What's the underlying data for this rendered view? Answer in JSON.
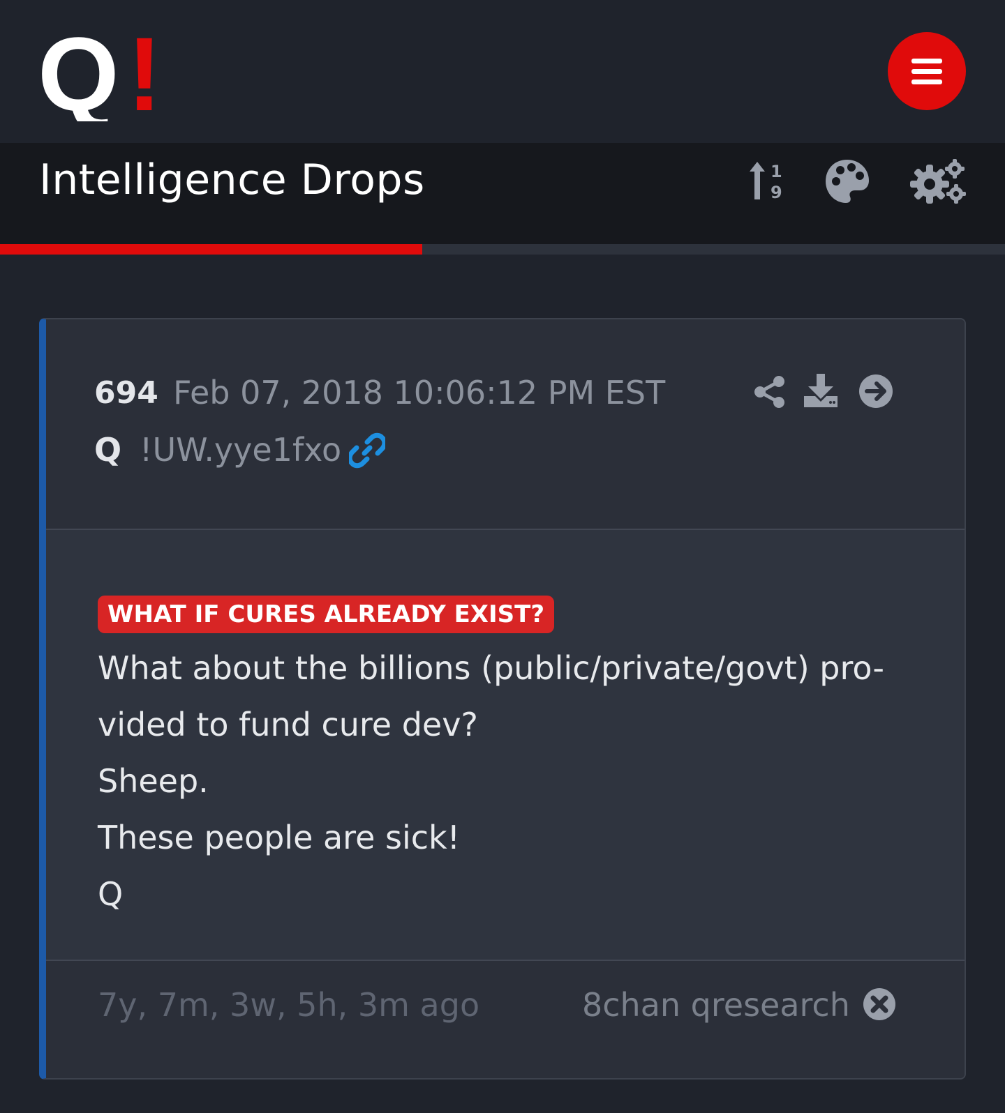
{
  "header": {
    "logo_letter": "Q",
    "logo_mark": "!",
    "menu_icon": "hamburger-icon",
    "accent_color": "#e00b0b"
  },
  "titlebar": {
    "title": "Intelligence Drops",
    "tools": [
      "sort-numeric-icon",
      "palette-icon",
      "gears-icon"
    ]
  },
  "progress": {
    "fraction": 0.42
  },
  "post": {
    "number": "694",
    "date": "Feb 07, 2018 10:06:12 PM EST",
    "author": "Q",
    "tripcode": "!UW.yye1fxo",
    "head_icons": [
      "share-icon",
      "download-icon",
      "arrow-right-circle-icon",
      "link-icon"
    ],
    "tag": "WHAT IF CURES ALREADY EXIST?",
    "lines": [
      "What about the billions (public/private/govt) pro-",
      "vided to fund cure dev?",
      "Sheep.",
      "These people are sick!",
      "Q"
    ],
    "ago": "7y, 7m, 3w, 5h, 3m ago",
    "source": "8chan qresearch",
    "border_color": "#1d5aa8",
    "tag_color": "#d82525"
  }
}
